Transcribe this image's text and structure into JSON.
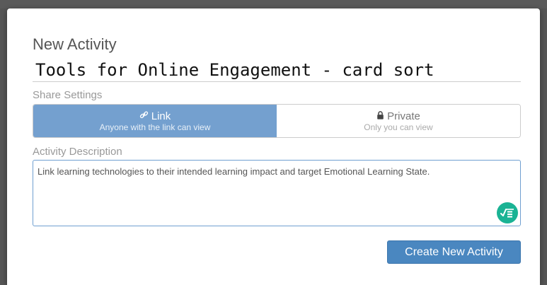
{
  "modal": {
    "title": "New Activity",
    "activity_name": "Tools for Online Engagement - card sort"
  },
  "share": {
    "label": "Share Settings",
    "options": [
      {
        "title": "Link",
        "subtitle": "Anyone with the link can view",
        "icon": "link-icon",
        "selected": true
      },
      {
        "title": "Private",
        "subtitle": "Only you can view",
        "icon": "lock-icon",
        "selected": false
      }
    ]
  },
  "description": {
    "label": "Activity Description",
    "value": "Link learning technologies to their intended learning impact and target Emotional Learning State."
  },
  "grammar_tool": {
    "icon": "grammar-check-icon",
    "color": "#1ab394"
  },
  "actions": {
    "create_label": "Create New Activity"
  },
  "colors": {
    "accent": "#4a87c0",
    "selected_toggle": "#74a0cf"
  }
}
